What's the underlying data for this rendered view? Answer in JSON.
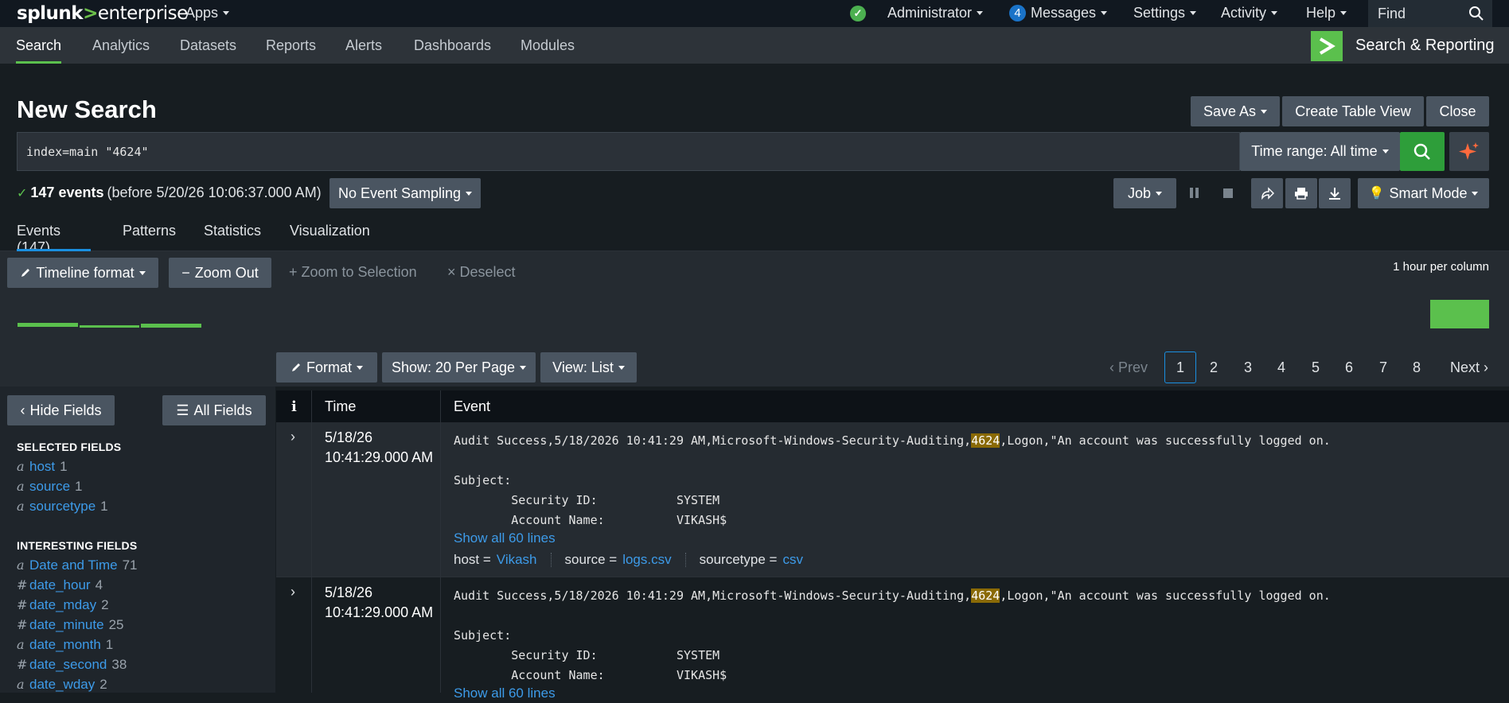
{
  "topbar": {
    "logo_main": "splunk",
    "logo_sep": ">",
    "logo_sub": "enterprise",
    "apps": "Apps",
    "user": "Administrator",
    "messages_count": "4",
    "messages": "Messages",
    "settings": "Settings",
    "activity": "Activity",
    "help": "Help",
    "find_placeholder": "Find"
  },
  "appnav": {
    "tabs": [
      "Search",
      "Analytics",
      "Datasets",
      "Reports",
      "Alerts",
      "Dashboards",
      "Modules"
    ],
    "app_name": "Search & Reporting"
  },
  "page": {
    "title": "New Search",
    "save_as": "Save As",
    "create_table_view": "Create Table View",
    "close": "Close"
  },
  "search": {
    "query": "index=main \"4624\"",
    "time_range": "Time range: All time"
  },
  "status": {
    "events_count": "147 events",
    "before": "(before 5/20/26 10:06:37.000 AM)",
    "sampling": "No Event Sampling",
    "job": "Job",
    "mode": "Smart Mode"
  },
  "results_tabs": [
    "Events (147)",
    "Patterns",
    "Statistics",
    "Visualization"
  ],
  "timeline": {
    "format": "Timeline format",
    "zoom_out": "Zoom Out",
    "zoom_selection": "Zoom to Selection",
    "deselect": "Deselect",
    "scale": "1 hour per column"
  },
  "controls": {
    "format": "Format",
    "per_page": "Show: 20 Per Page",
    "view": "View: List",
    "prev": "Prev",
    "next": "Next",
    "pages": [
      "1",
      "2",
      "3",
      "4",
      "5",
      "6",
      "7",
      "8"
    ]
  },
  "sidebar": {
    "hide_fields": "Hide Fields",
    "all_fields": "All Fields",
    "selected_header": "SELECTED FIELDS",
    "selected": [
      {
        "type": "a",
        "name": "host",
        "count": "1"
      },
      {
        "type": "a",
        "name": "source",
        "count": "1"
      },
      {
        "type": "a",
        "name": "sourcetype",
        "count": "1"
      }
    ],
    "interesting_header": "INTERESTING FIELDS",
    "interesting": [
      {
        "type": "a",
        "name": "Date and Time",
        "count": "71"
      },
      {
        "type": "#",
        "name": "date_hour",
        "count": "4"
      },
      {
        "type": "#",
        "name": "date_mday",
        "count": "2"
      },
      {
        "type": "#",
        "name": "date_minute",
        "count": "25"
      },
      {
        "type": "a",
        "name": "date_month",
        "count": "1"
      },
      {
        "type": "#",
        "name": "date_second",
        "count": "38"
      },
      {
        "type": "a",
        "name": "date_wday",
        "count": "2"
      }
    ]
  },
  "table": {
    "col_info": "i",
    "col_time": "Time",
    "col_event": "Event"
  },
  "events": [
    {
      "date": "5/18/26",
      "time": "10:41:29.000 AM",
      "line1_pre": "Audit Success,5/18/2026 10:41:29 AM,Microsoft-Windows-Security-Auditing,",
      "line1_hl": "4624",
      "line1_post": ",Logon,\"An account was successfully logged on.",
      "subject": "Subject:",
      "sec_id_label": "        Security ID:",
      "sec_id_value": "SYSTEM",
      "acct_label": "        Account Name:",
      "acct_value": "VIKASH$",
      "show_all": "Show all 60 lines",
      "host_label": "host =",
      "host": "Vikash",
      "source_label": "source =",
      "source": "logs.csv",
      "sourcetype_label": "sourcetype =",
      "sourcetype": "csv"
    },
    {
      "date": "5/18/26",
      "time": "10:41:29.000 AM",
      "line1_pre": "Audit Success,5/18/2026 10:41:29 AM,Microsoft-Windows-Security-Auditing,",
      "line1_hl": "4624",
      "line1_post": ",Logon,\"An account was successfully logged on.",
      "subject": "Subject:",
      "sec_id_label": "        Security ID:",
      "sec_id_value": "SYSTEM",
      "acct_label": "        Account Name:",
      "acct_value": "VIKASH$",
      "show_all": "Show all 60 lines"
    }
  ]
}
